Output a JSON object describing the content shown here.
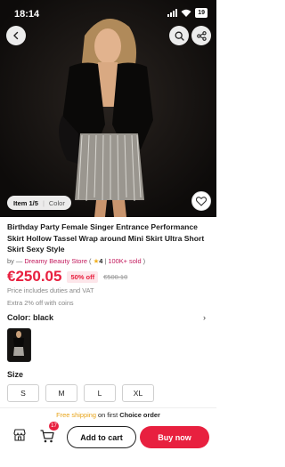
{
  "status_bar": {
    "time": "18:14",
    "battery": "19"
  },
  "gallery": {
    "index_label": "Item 1/5",
    "tab_label": "Color"
  },
  "product": {
    "title": "Birthday Party Female Singer Entrance Performance Skirt Hollow Tassel Wrap around Mini Skirt Ultra Short Skirt Sexy Style",
    "store_prefix": "by",
    "store_name": "Dreamy Beauty Store",
    "rating": "4",
    "sold": "100K+ sold",
    "price": "€250.05",
    "discount": "50% off",
    "original_price": "€500.10",
    "vat_note": "Price includes duties and VAT",
    "coins_note": "Extra 2% off with coins"
  },
  "color": {
    "label": "Color: black",
    "accent": "#141210"
  },
  "size": {
    "label": "Size",
    "options": [
      "S",
      "M",
      "L",
      "XL"
    ]
  },
  "shipping": {
    "free_text": "Free shipping",
    "rest_text": " on first ",
    "choice_text": "Choice order"
  },
  "actions": {
    "cart_count": "17",
    "add_to_cart": "Add to cart",
    "buy_now": "Buy now"
  },
  "icons": {
    "back": "chevron-left-icon",
    "search": "search-icon",
    "share": "share-icon",
    "favorite": "heart-icon",
    "store": "store-icon",
    "cart": "cart-icon"
  },
  "colors": {
    "accent_red": "#e8203f",
    "store_pink": "#c2185b",
    "shipping_gold": "#e8a317"
  }
}
